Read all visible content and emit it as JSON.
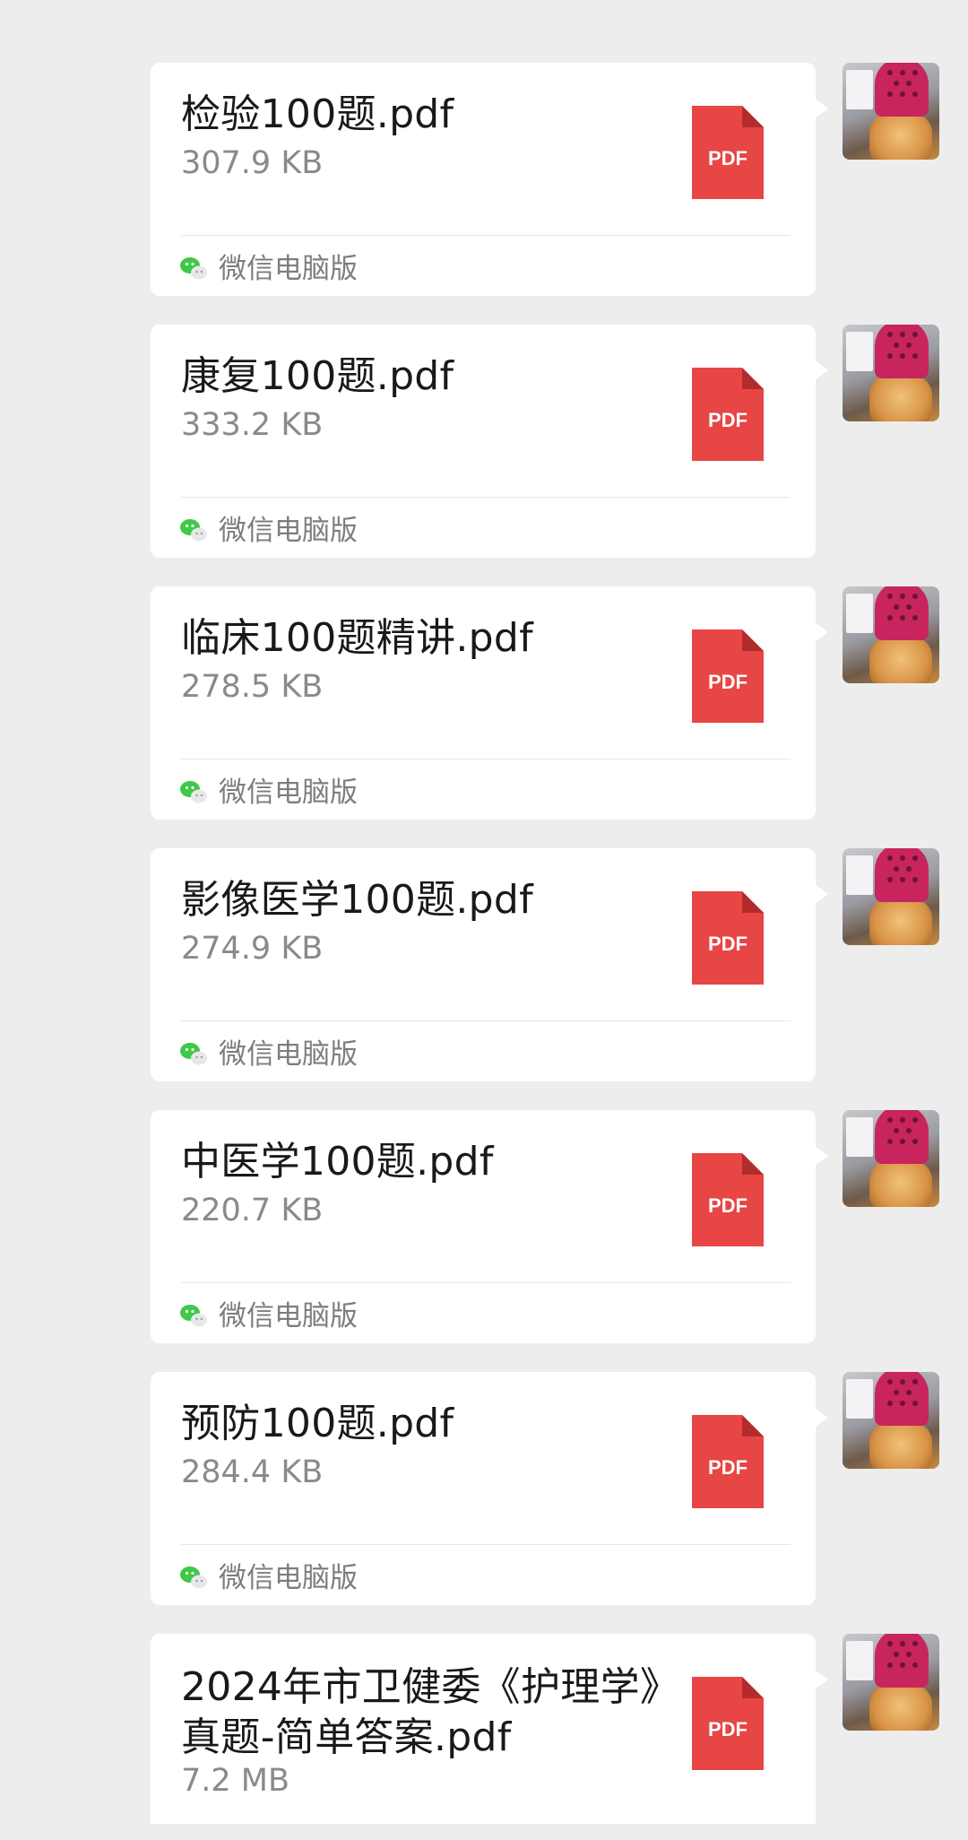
{
  "messages": [
    {
      "file_name": "检验100题.pdf",
      "file_size": "307.9 KB",
      "file_type": "PDF",
      "source": "微信电脑版"
    },
    {
      "file_name": "康复100题.pdf",
      "file_size": "333.2 KB",
      "file_type": "PDF",
      "source": "微信电脑版"
    },
    {
      "file_name": "临床100题精讲.pdf",
      "file_size": "278.5 KB",
      "file_type": "PDF",
      "source": "微信电脑版"
    },
    {
      "file_name": "影像医学100题.pdf",
      "file_size": "274.9 KB",
      "file_type": "PDF",
      "source": "微信电脑版"
    },
    {
      "file_name": "中医学100题.pdf",
      "file_size": "220.7 KB",
      "file_type": "PDF",
      "source": "微信电脑版"
    },
    {
      "file_name": "预防100题.pdf",
      "file_size": "284.4 KB",
      "file_type": "PDF",
      "source": "微信电脑版"
    },
    {
      "file_name": "2024年市卫健委《护理学》真题-简单答案.pdf",
      "file_size": "7.2 MB",
      "file_type": "PDF"
    }
  ],
  "icons": {
    "file": "pdf-file-icon",
    "source": "wechat-icon",
    "avatar": "user-avatar"
  },
  "colors": {
    "background": "#ededed",
    "bubble": "#ffffff",
    "pdf_red": "#e84545",
    "pdf_fold": "#b32c2c",
    "wechat_green": "#3fc84a",
    "title_text": "#191919",
    "secondary_text": "#8a8a8a"
  }
}
